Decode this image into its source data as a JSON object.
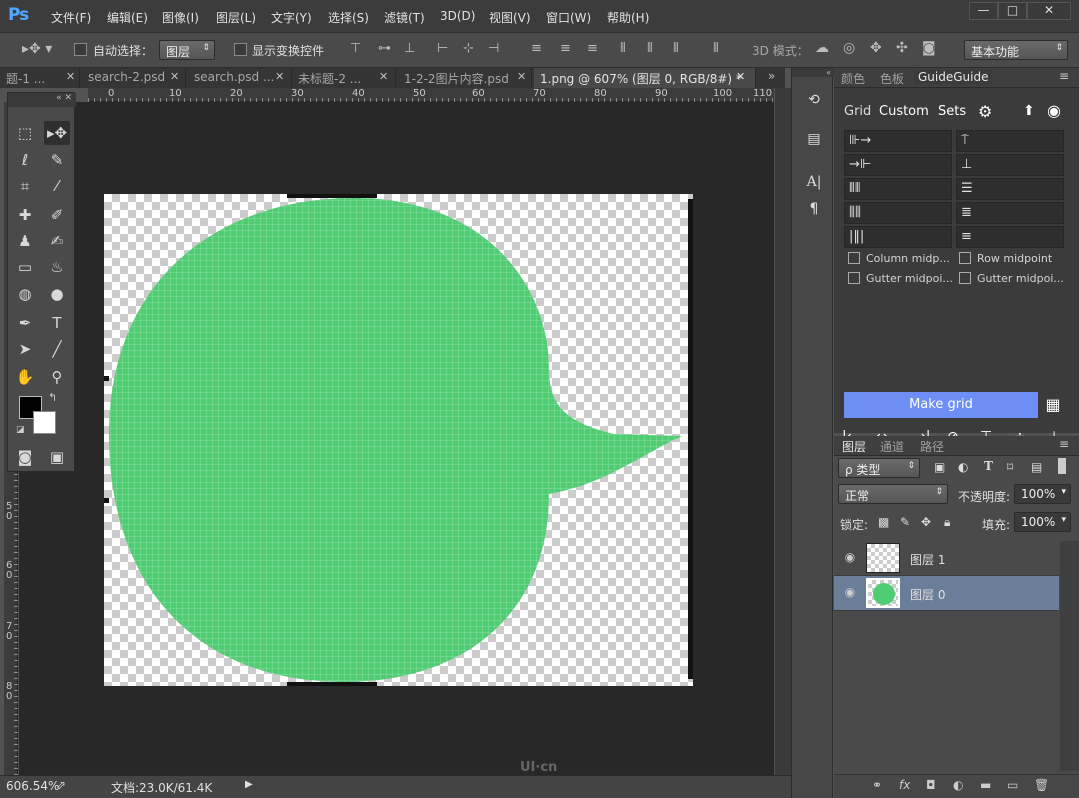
{
  "app": {
    "logo": "Ps"
  },
  "menu": [
    "文件(F)",
    "编辑(E)",
    "图像(I)",
    "图层(L)",
    "文字(Y)",
    "选择(S)",
    "滤镜(T)",
    "3D(D)",
    "视图(V)",
    "窗口(W)",
    "帮助(H)"
  ],
  "window_controls": {
    "minimize": "—",
    "restore": "□",
    "close": "✕"
  },
  "options": {
    "auto_select_label": "自动选择：",
    "auto_select_value": "图层",
    "show_transform_label": "显示变换控件",
    "mode3d_label": "3D 模式：",
    "workspace": "基本功能"
  },
  "tabs": [
    {
      "label": "题-1 ...",
      "active": false
    },
    {
      "label": "search-2.psd",
      "active": false
    },
    {
      "label": "search.psd ...",
      "active": false
    },
    {
      "label": "未标题-2 ...",
      "active": false
    },
    {
      "label": "1-2-2图片内容.psd",
      "active": false
    },
    {
      "label": "1.png @ 607% (图层 0, RGB/8#) *",
      "active": true
    }
  ],
  "tabs_more": "»",
  "ruler_top_ticks": [
    "0",
    "10",
    "20",
    "30",
    "40",
    "50",
    "60",
    "70",
    "80",
    "90",
    "100",
    "110"
  ],
  "ruler_left_ticks": [
    "5\n0",
    "6\n0",
    "7\n0",
    "8\n0"
  ],
  "statusbar": {
    "zoom": "606.54%",
    "doc": "文档:23.0K/61.4K",
    "arrow": "▶"
  },
  "watermark": "UI·cn",
  "panel_top_tabs": {
    "color": "颜色",
    "swatches": "色板",
    "guideguide": "GuideGuide"
  },
  "guideguide": {
    "header": {
      "grid": "Grid",
      "custom": "Custom",
      "sets": "Sets"
    },
    "checks": {
      "col_mid": "Column midp...",
      "row_mid": "Row midpoint",
      "gutter_col": "Gutter midpoi...",
      "gutter_row": "Gutter midpoi..."
    },
    "make_grid": "Make grid"
  },
  "layers_panel": {
    "tabs": {
      "layers": "图层",
      "channels": "通道",
      "paths": "路径"
    },
    "filter": "ρ 类型",
    "blend": "正常",
    "opacity_label": "不透明度:",
    "opacity": "100%",
    "lock_label": "锁定:",
    "fill_label": "填充:",
    "fill": "100%",
    "layers": [
      {
        "name": "图层 1",
        "selected": false
      },
      {
        "name": "图层 0",
        "selected": true
      }
    ]
  },
  "colors": {
    "accent": "#6c8ef5",
    "shape": "#4fcd72",
    "canvas": "#282828"
  }
}
